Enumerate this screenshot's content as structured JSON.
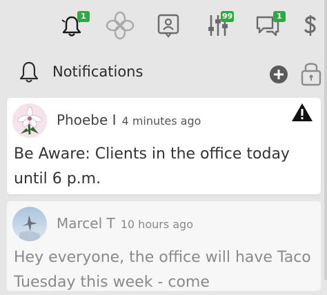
{
  "toolbar": {
    "items": [
      {
        "icon": "bell-icon",
        "badge": "1"
      },
      {
        "icon": "flower-icon",
        "badge": ""
      },
      {
        "icon": "contact-card-icon",
        "badge": ""
      },
      {
        "icon": "sliders-icon",
        "badge": "99"
      },
      {
        "icon": "chat-icon",
        "badge": "1"
      },
      {
        "icon": "dollar-icon",
        "badge": ""
      }
    ]
  },
  "header": {
    "title": "Notifications",
    "icons": [
      "bell-icon",
      "add-icon",
      "lock-icon"
    ]
  },
  "notifications": [
    {
      "author": "Phoebe I",
      "time": "4 minutes ago",
      "message": "Be Aware: Clients in the office today until 6 p.m.",
      "icon": "warning-icon",
      "state": "unread"
    },
    {
      "author": "Marcel T",
      "time": "10 hours ago",
      "message": "Hey everyone, the office will have Taco Tuesday this week - come",
      "state": "read"
    }
  ],
  "colors": {
    "background": "#e6e6e6",
    "badge": "#2faa42",
    "card_active": "#ffffff",
    "card_read": "#f7f7f7",
    "icon_gray": "#6b6b6b"
  }
}
